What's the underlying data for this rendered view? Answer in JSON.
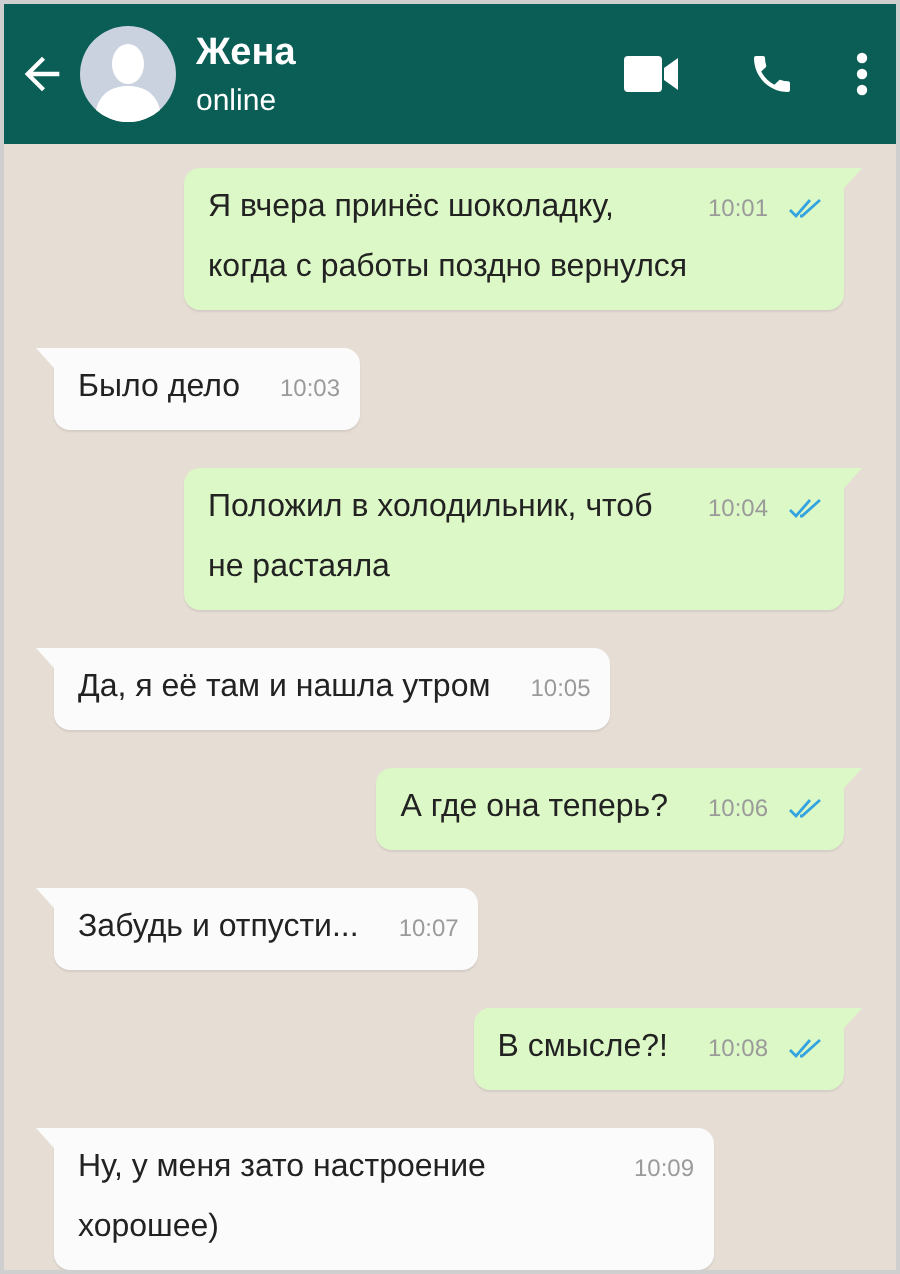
{
  "header": {
    "name": "Жена",
    "status": "online"
  },
  "messages": [
    {
      "kind": "out",
      "text": "Я вчера принёс шоколадку, когда с работы поздно вернулся",
      "time": "10:01",
      "read": true
    },
    {
      "kind": "in",
      "text": "Было дело",
      "time": "10:03"
    },
    {
      "kind": "out",
      "text": "Положил в холодильник, чтоб не растаяла",
      "time": "10:04",
      "read": true
    },
    {
      "kind": "in",
      "text": "Да, я её там и нашла утром",
      "time": "10:05"
    },
    {
      "kind": "out",
      "text": "А где она теперь?",
      "time": "10:06",
      "read": true
    },
    {
      "kind": "in",
      "text": "Забудь и отпусти...",
      "time": "10:07"
    },
    {
      "kind": "out",
      "text": "В смысле?!",
      "time": "10:08",
      "read": true
    },
    {
      "kind": "in",
      "text": "Ну, у меня зато настроение хорошее)",
      "time": "10:09"
    }
  ]
}
